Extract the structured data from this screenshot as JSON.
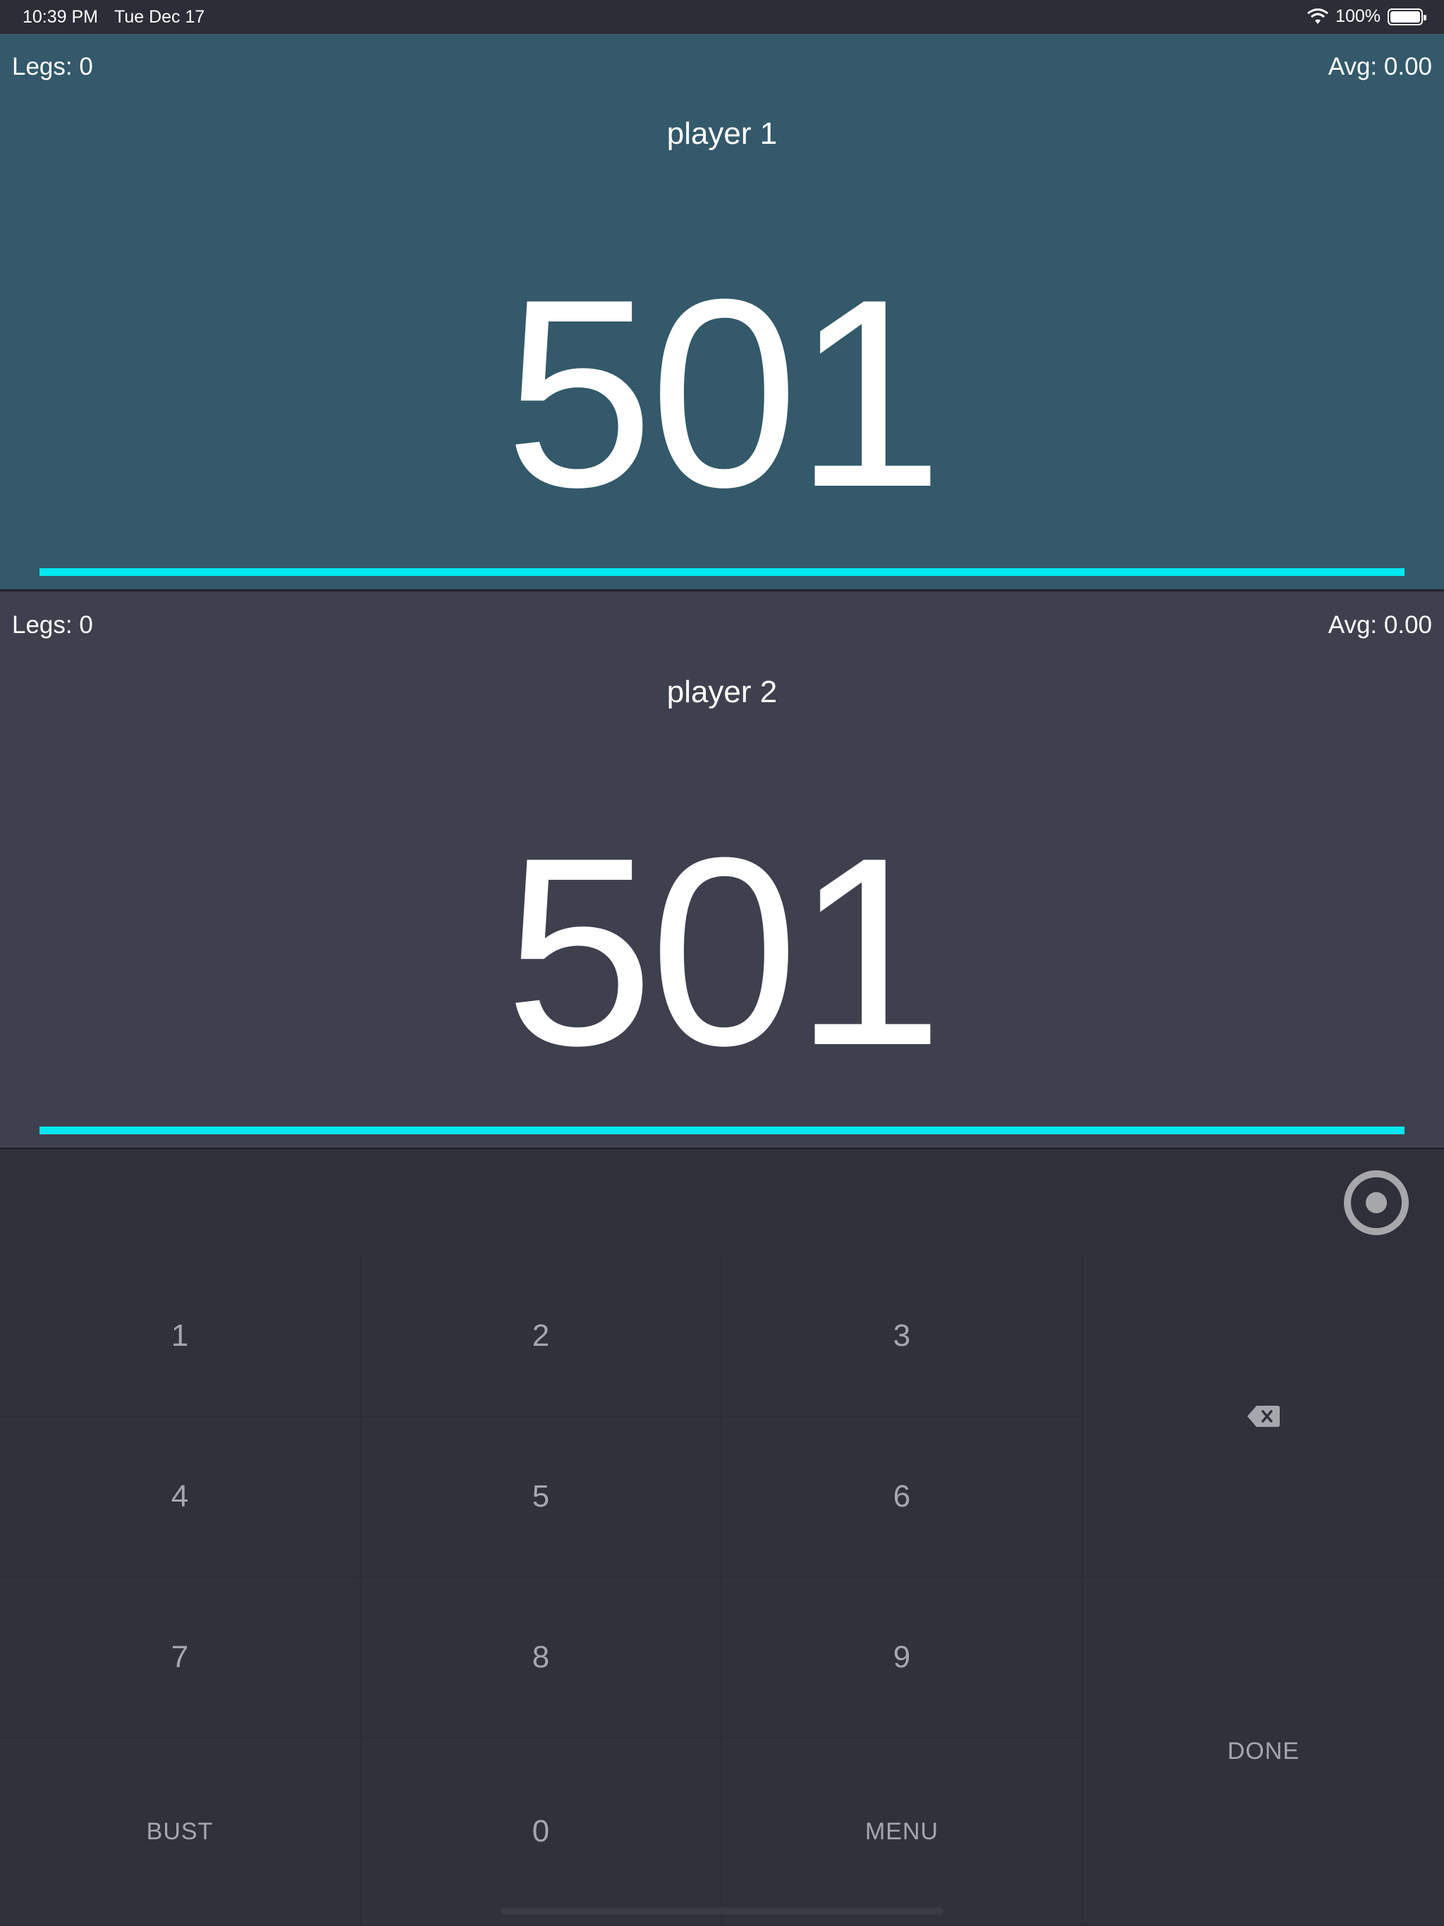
{
  "status_bar": {
    "time": "10:39 PM",
    "date": "Tue Dec 17",
    "battery": "100%"
  },
  "players": [
    {
      "legs": "Legs: 0",
      "avg": "Avg: 0.00",
      "name": "player 1",
      "score": "501",
      "progress": 1.0,
      "active": true
    },
    {
      "legs": "Legs: 0",
      "avg": "Avg: 0.00",
      "name": "player 2",
      "score": "501",
      "progress": 1.0,
      "active": false
    }
  ],
  "keypad": {
    "keys": [
      "1",
      "2",
      "3",
      "4",
      "5",
      "6",
      "7",
      "8",
      "9",
      "0"
    ],
    "bust": "BUST",
    "menu": "MENU",
    "done": "DONE",
    "icons": {
      "target": "target-icon",
      "backspace": "backspace-icon"
    }
  },
  "colors": {
    "player1_bg": "#33596a",
    "player2_bg": "#3f404e",
    "progress": "#00e8f0",
    "keypad_bg": "#2f3039",
    "key_text": "#a6a7ad"
  }
}
